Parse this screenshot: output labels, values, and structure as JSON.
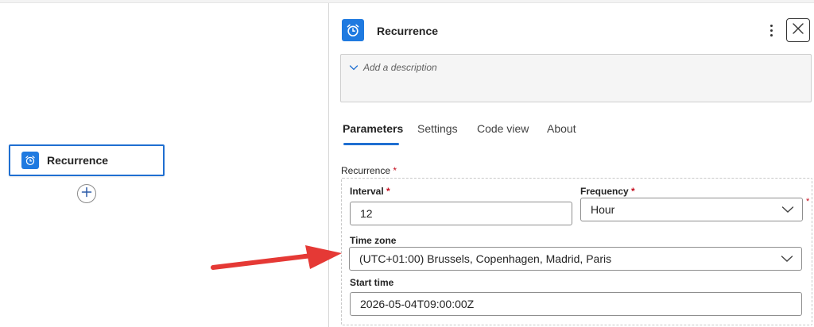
{
  "canvas": {
    "node": {
      "label": "Recurrence",
      "icon": "alarm-clock-icon"
    },
    "add_button": {
      "icon": "plus-icon"
    }
  },
  "panel": {
    "title": "Recurrence",
    "header_icon": "alarm-clock-icon",
    "more_icon": "more-vertical-icon",
    "close_icon": "close-icon",
    "description_placeholder": "Add a description",
    "tabs": [
      {
        "label": "Parameters",
        "active": true
      },
      {
        "label": "Settings",
        "active": false
      },
      {
        "label": "Code view",
        "active": false
      },
      {
        "label": "About",
        "active": false
      }
    ],
    "section": {
      "label": "Recurrence",
      "required_mark": "*"
    },
    "fields": {
      "interval": {
        "label": "Interval",
        "required_mark": "*",
        "value": "12"
      },
      "frequency": {
        "label": "Frequency",
        "required_mark": "*",
        "value": "Hour"
      },
      "time_zone": {
        "label": "Time zone",
        "value": "(UTC+01:00) Brussels, Copenhagen, Madrid, Paris"
      },
      "start_time": {
        "label": "Start time",
        "value": "2026-05-04T09:00:00Z"
      }
    },
    "side_required_mark": "*"
  },
  "colors": {
    "accent": "#1f6fd1",
    "icon_bg": "#1f7ae0",
    "required": "#c50f1f",
    "annotation_arrow": "#e53935"
  }
}
